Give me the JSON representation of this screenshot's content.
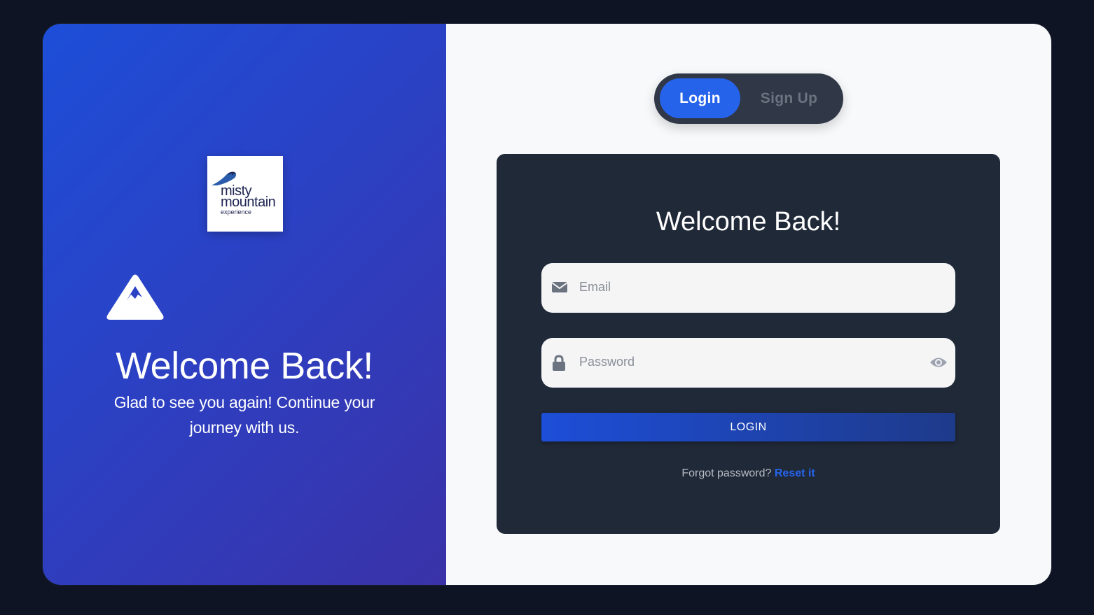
{
  "brand": {
    "logo_line1": "misty",
    "logo_line2": "mountain",
    "logo_line3": "experience"
  },
  "left_panel": {
    "title": "Welcome Back!",
    "subtitle": "Glad to see you again! Continue your journey with us.",
    "icon": "mountain-icon"
  },
  "toggle": {
    "login_label": "Login",
    "signup_label": "Sign Up",
    "active": "Login"
  },
  "form": {
    "title": "Welcome Back!",
    "email_placeholder": "Email",
    "password_placeholder": "Password",
    "submit_label": "LOGIN",
    "forgot_text": "Forgot password?",
    "reset_link": "Reset it"
  },
  "colors": {
    "accent": "#2563eb",
    "background": "#0e1423",
    "card": "#202938"
  }
}
